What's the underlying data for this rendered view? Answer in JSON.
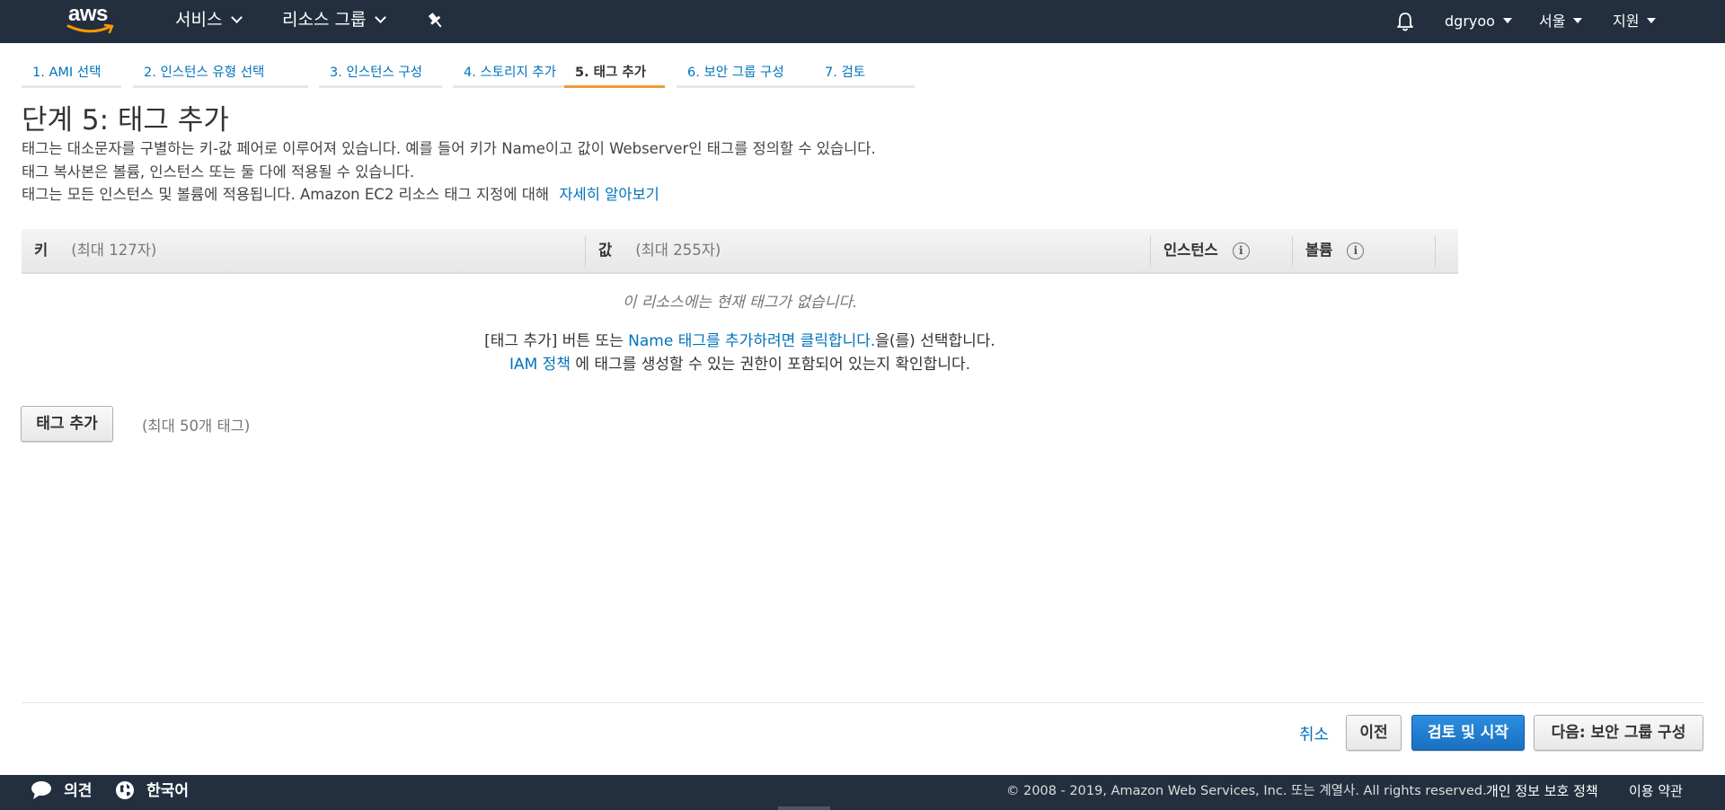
{
  "topnav": {
    "logo_text": "aws",
    "services": "서비스",
    "resource_groups": "리소스 그룹",
    "user": "dgryoo",
    "region": "서울",
    "support": "지원"
  },
  "steps": [
    {
      "label": "1. AMI 선택",
      "active": false
    },
    {
      "label": "2. 인스턴스 유형 선택",
      "active": false
    },
    {
      "label": "3. 인스턴스 구성",
      "active": false
    },
    {
      "label": "4. 스토리지 추가",
      "active": false
    },
    {
      "label": "5. 태그 추가",
      "active": true
    },
    {
      "label": "6. 보안 그룹 구성",
      "active": false
    },
    {
      "label": "7. 검토",
      "active": false
    }
  ],
  "page": {
    "title": "단계 5: 태그 추가",
    "desc1": "태그는 대소문자를 구별하는 키-값 페어로 이루어져 있습니다. 예를 들어 키가 Name이고 값이 Webserver인 태그를 정의할 수 있습니다.",
    "desc2": "태그 복사본은 볼륨, 인스턴스 또는 둘 다에 적용될 수 있습니다.",
    "desc3": "태그는 모든 인스턴스 및 볼륨에 적용됩니다. Amazon EC2 리소스 태그 지정에 대해",
    "learn_more": "자세히 알아보기"
  },
  "table": {
    "key_label": "키",
    "key_hint": "(최대 127자)",
    "value_label": "값",
    "value_hint": "(최대 255자)",
    "instances_label": "인스턴스",
    "volumes_label": "볼륨",
    "empty_message": "이 리소스에는 현재 태그가 없습니다.",
    "hint1_prefix": "[태그 추가] 버튼 또는",
    "hint1_link": "Name 태그를 추가하려면 클릭합니다.",
    "hint1_suffix": "을(를) 선택합니다.",
    "hint2_link": "IAM 정책",
    "hint2_text": "에 태그를 생성할 수 있는 권한이 포함되어 있는지 확인합니다."
  },
  "add_tag": {
    "button": "태그 추가",
    "limit": "(최대 50개 태그)"
  },
  "actions": {
    "cancel": "취소",
    "previous": "이전",
    "review_launch": "검토 및 시작",
    "next": "다음: 보안 그룹 구성"
  },
  "footer": {
    "feedback": "의견",
    "language": "한국어",
    "copyright": "© 2008 - 2019, Amazon Web Services, Inc. 또는 계열사. All rights reserved.",
    "privacy": "개인 정보 보호 정책",
    "terms": "이용 약관"
  },
  "colors": {
    "nav_bg": "#232f3e",
    "link": "#0073bb",
    "active_step": "#ec9b3a",
    "primary_button": "#1a6fc0"
  }
}
